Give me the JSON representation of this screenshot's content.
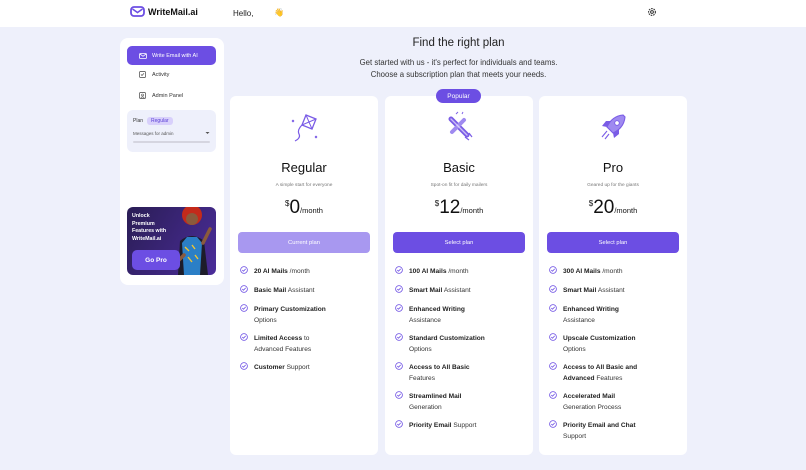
{
  "header": {
    "logo_text": "WriteMail.ai",
    "greeting": "Hello,",
    "wave": "👋"
  },
  "sidebar": {
    "primary_item": "Write Email with AI",
    "items": [
      {
        "label": "Activity",
        "icon": "activity-icon"
      },
      {
        "label": "Admin Panel",
        "icon": "admin-icon"
      }
    ],
    "plan_label": "Plan",
    "plan_badge": "Regular",
    "plan_sub": "Messages for admin"
  },
  "promo": {
    "line1": "Unlock",
    "line2": "Premium",
    "line3": "Features with",
    "line4": "WriteMail.ai",
    "button": "Go Pro"
  },
  "main": {
    "title": "Find the right plan",
    "subtitle1": "Get started with us - it's perfect for individuals and teams.",
    "subtitle2": "Choose a subscription plan that meets your needs."
  },
  "plans": [
    {
      "name": "Regular",
      "tagline": "A simple start for everyone",
      "currency": "$",
      "amount": "0",
      "period": "/month",
      "button": "Current plan",
      "features": [
        {
          "bold": "20 AI Mails",
          "rest": " /month"
        },
        {
          "bold": "Basic Mail",
          "rest": " Assistant"
        },
        {
          "bold": "Primary Customization",
          "rest": "Options"
        },
        {
          "bold": "Limited Access",
          "rest": " to Advanced Features"
        },
        {
          "bold": "Customer",
          "rest": " Support"
        }
      ]
    },
    {
      "name": "Basic",
      "popular": "Popular",
      "tagline": "Spot-on fit for daily mailers",
      "currency": "$",
      "amount": "12",
      "period": "/month",
      "button": "Select plan",
      "features": [
        {
          "bold": "100 AI Mails",
          "rest": " /month"
        },
        {
          "bold": "Smart Mail",
          "rest": " Assistant"
        },
        {
          "bold": "Enhanced Writing",
          "rest": "Assistance"
        },
        {
          "bold": "Standard Customization",
          "rest": "Options"
        },
        {
          "bold": "Access to All Basic",
          "rest": "Features"
        },
        {
          "bold": "Streamlined Mail",
          "rest": "Generation"
        },
        {
          "bold": "Priority Email",
          "rest": " Support"
        }
      ]
    },
    {
      "name": "Pro",
      "tagline": "Geared up for the giants",
      "currency": "$",
      "amount": "20",
      "period": "/month",
      "button": "Select plan",
      "features": [
        {
          "bold": "300 AI Mails",
          "rest": " /month"
        },
        {
          "bold": "Smart Mail",
          "rest": " Assistant"
        },
        {
          "bold": "Enhanced Writing",
          "rest": "Assistance"
        },
        {
          "bold": "Upscale Customization",
          "rest": "Options"
        },
        {
          "bold": "Access to All Basic and Advanced",
          "rest": " Features"
        },
        {
          "bold": "Accelerated Mail",
          "rest": "Generation Process"
        },
        {
          "bold": "Priority Email and Chat",
          "rest": "Support"
        }
      ]
    }
  ],
  "colors": {
    "accent": "#6c4ee3",
    "accent_light": "#a898f0",
    "background": "#eef0fb"
  }
}
